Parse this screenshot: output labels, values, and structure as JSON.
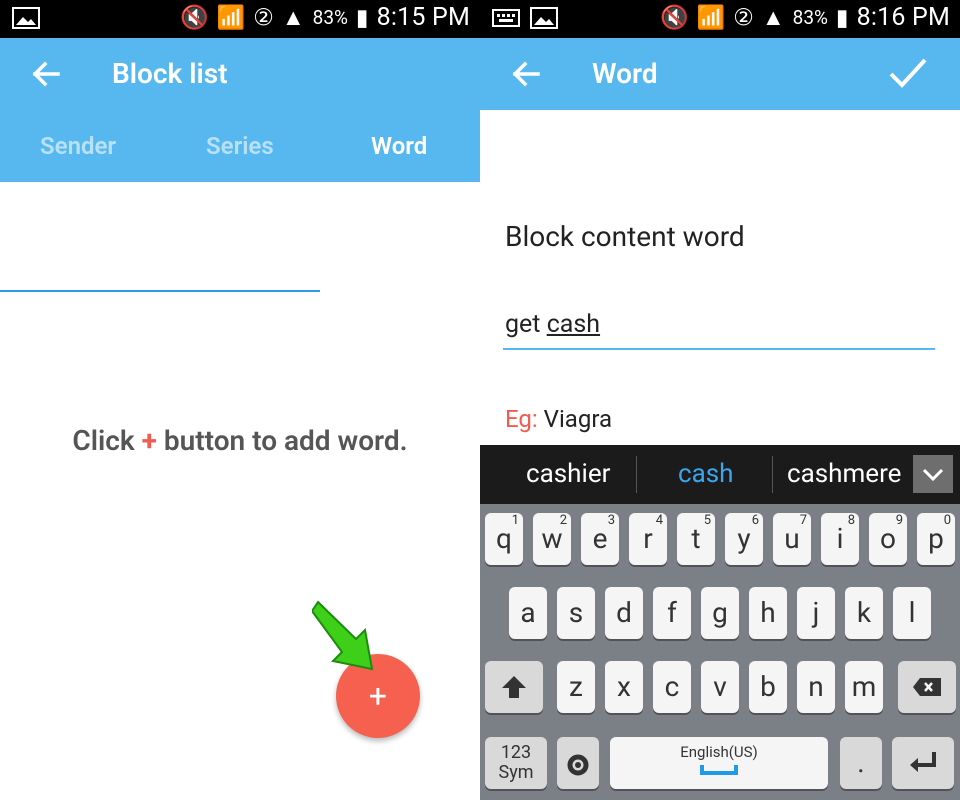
{
  "left": {
    "status": {
      "time": "8:15 PM",
      "battery": "83%"
    },
    "appbar": {
      "title": "Block list"
    },
    "tabs": [
      "Sender",
      "Series",
      "Word"
    ],
    "empty": {
      "pre": "Click",
      "plus": "+",
      "post": "button to add word."
    },
    "fab": {
      "label": "+"
    }
  },
  "right": {
    "status": {
      "time": "8:16 PM",
      "battery": "83%"
    },
    "appbar": {
      "title": "Word"
    },
    "form": {
      "label": "Block content word",
      "value_pre": "get",
      "value_underlined": "cash",
      "hint_prefix": "Eg:",
      "hint_value": "Viagra"
    },
    "suggestions": [
      "cashier",
      "cash",
      "cashmere"
    ],
    "keys": {
      "row1": [
        [
          "q",
          "1"
        ],
        [
          "w",
          "2"
        ],
        [
          "e",
          "3"
        ],
        [
          "r",
          "4"
        ],
        [
          "t",
          "5"
        ],
        [
          "y",
          "6"
        ],
        [
          "u",
          "7"
        ],
        [
          "i",
          "8"
        ],
        [
          "o",
          "9"
        ],
        [
          "p",
          "0"
        ]
      ],
      "row2": [
        "a",
        "s",
        "d",
        "f",
        "g",
        "h",
        "j",
        "k",
        "l"
      ],
      "row3": [
        "z",
        "x",
        "c",
        "v",
        "b",
        "n",
        "m"
      ],
      "space_label": "English(US)",
      "sym_label": "123\nSym"
    }
  }
}
